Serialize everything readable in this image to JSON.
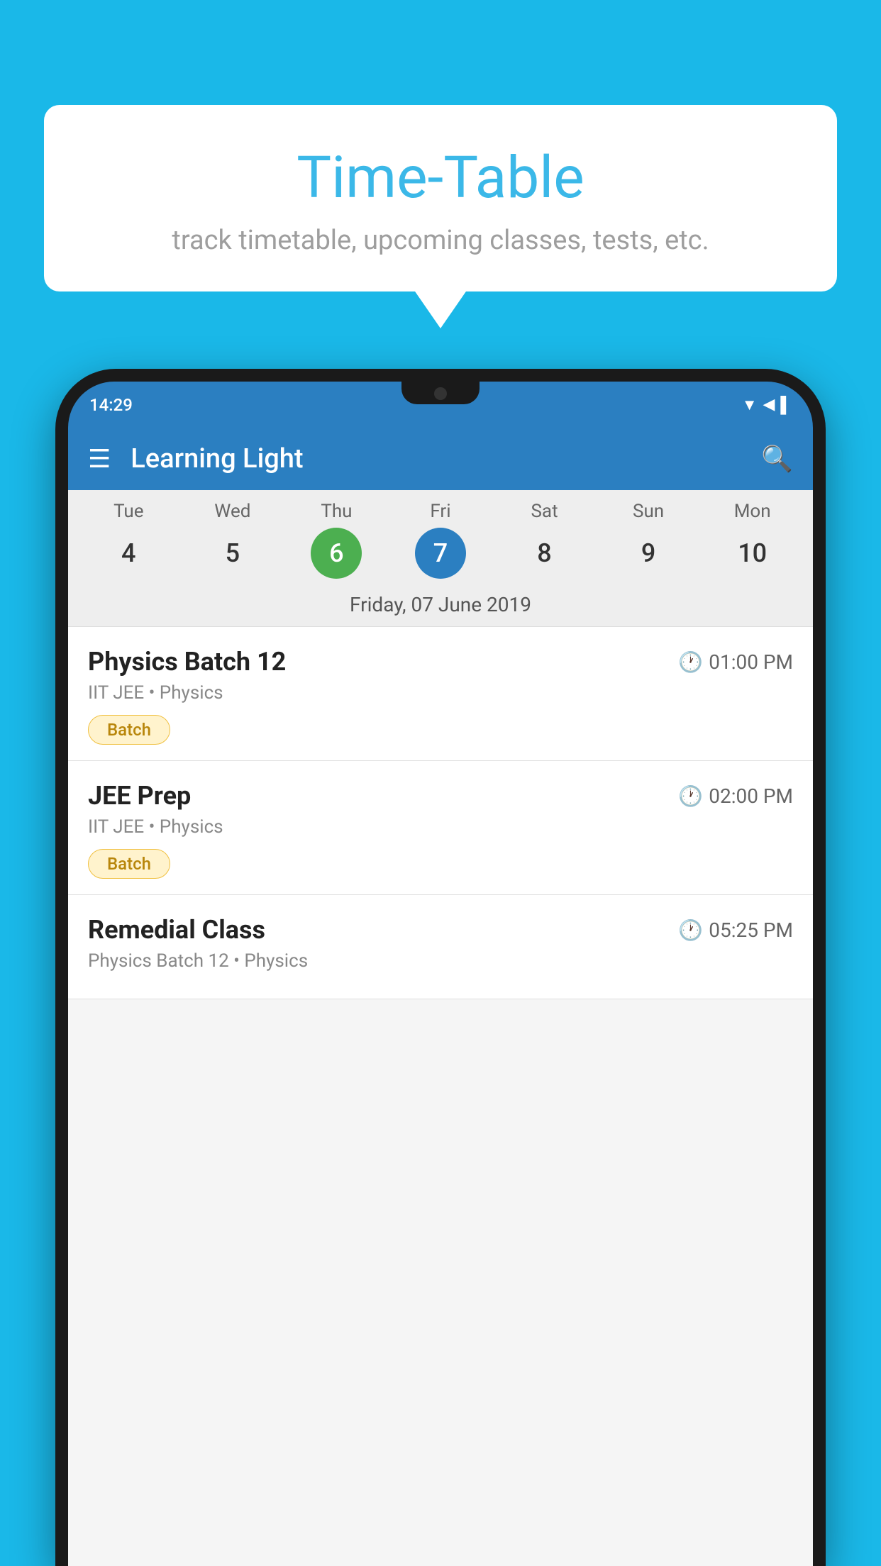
{
  "background_color": "#1ab8e8",
  "speech_bubble": {
    "title": "Time-Table",
    "subtitle": "track timetable, upcoming classes, tests, etc."
  },
  "phone": {
    "status_bar": {
      "time": "14:29",
      "icons": [
        "wifi",
        "signal",
        "battery"
      ]
    },
    "app_header": {
      "title": "Learning Light",
      "menu_icon": "≡",
      "search_icon": "🔍"
    },
    "calendar": {
      "days": [
        {
          "label": "Tue",
          "number": "4",
          "state": "normal"
        },
        {
          "label": "Wed",
          "number": "5",
          "state": "normal"
        },
        {
          "label": "Thu",
          "number": "6",
          "state": "today"
        },
        {
          "label": "Fri",
          "number": "7",
          "state": "selected"
        },
        {
          "label": "Sat",
          "number": "8",
          "state": "normal"
        },
        {
          "label": "Sun",
          "number": "9",
          "state": "normal"
        },
        {
          "label": "Mon",
          "number": "10",
          "state": "normal"
        }
      ],
      "selected_date_label": "Friday, 07 June 2019"
    },
    "schedule_items": [
      {
        "name": "Physics Batch 12",
        "time": "01:00 PM",
        "sub": "IIT JEE • Physics",
        "tag": "Batch"
      },
      {
        "name": "JEE Prep",
        "time": "02:00 PM",
        "sub": "IIT JEE • Physics",
        "tag": "Batch"
      },
      {
        "name": "Remedial Class",
        "time": "05:25 PM",
        "sub": "Physics Batch 12 • Physics",
        "tag": ""
      }
    ]
  }
}
